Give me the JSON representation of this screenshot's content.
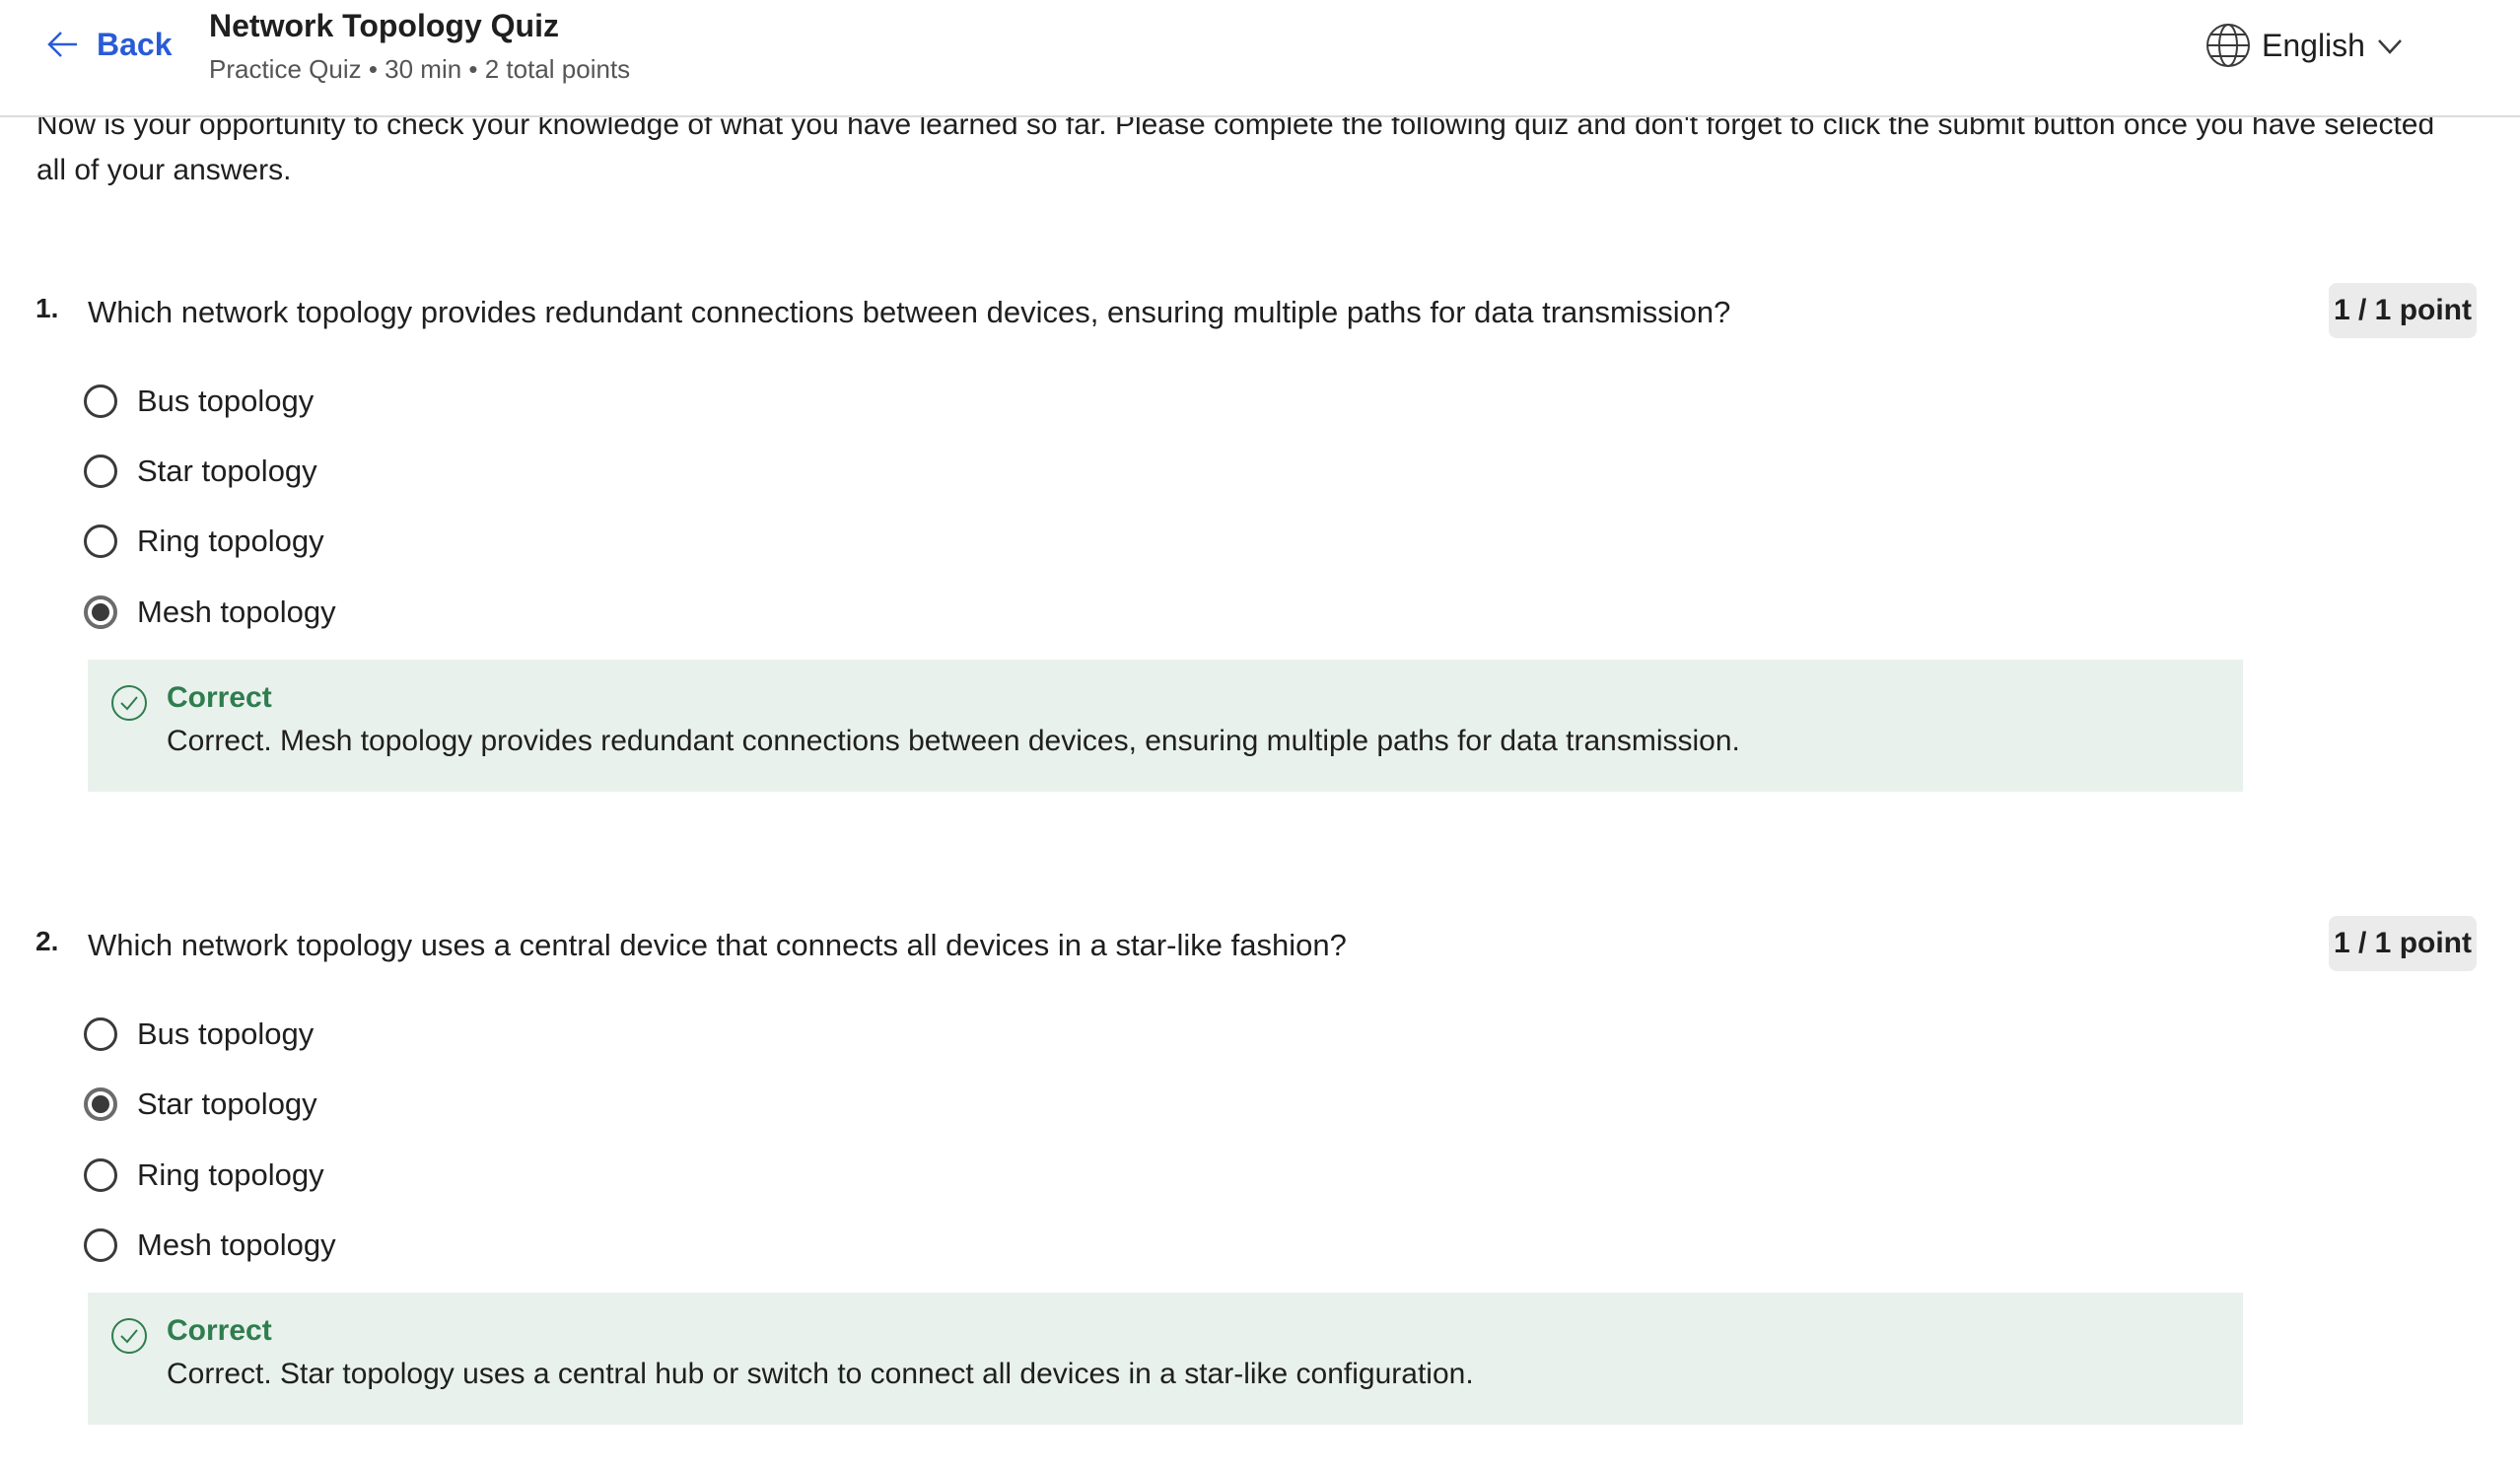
{
  "header": {
    "back_label": "Back",
    "title": "Network Topology Quiz",
    "meta": "Practice Quiz • 30 min • 2 total points",
    "language": "English"
  },
  "intro": "Now is your opportunity to check your knowledge of what you have learned so far. Please complete the following quiz and don't forget to click the submit button once you have selected all of your answers.",
  "questions": [
    {
      "number": "1.",
      "text": "Which network topology provides redundant connections between devices, ensuring multiple paths for data transmission?",
      "points": "1 / 1 point",
      "options": [
        "Bus topology",
        "Star topology",
        "Ring topology",
        "Mesh topology"
      ],
      "selected": 3,
      "feedback_title": "Correct",
      "feedback_text": "Correct. Mesh topology provides redundant connections between devices, ensuring multiple paths for data transmission."
    },
    {
      "number": "2.",
      "text": "Which network topology uses a central device that connects all devices in a star-like fashion?",
      "points": "1 / 1 point",
      "options": [
        "Bus topology",
        "Star topology",
        "Ring topology",
        "Mesh topology"
      ],
      "selected": 1,
      "feedback_title": "Correct",
      "feedback_text": "Correct. Star topology uses a central hub or switch to connect all devices in a star-like configuration."
    }
  ],
  "colors": {
    "accent": "#2a5bd7",
    "correct": "#2f7d4f",
    "feedback_bg": "#e9f1ec",
    "points_bg": "#ebebeb"
  },
  "icons": {
    "back": "arrow-left-icon",
    "language": "globe-icon",
    "dropdown": "chevron-down-icon",
    "correct": "check-circle-icon"
  }
}
